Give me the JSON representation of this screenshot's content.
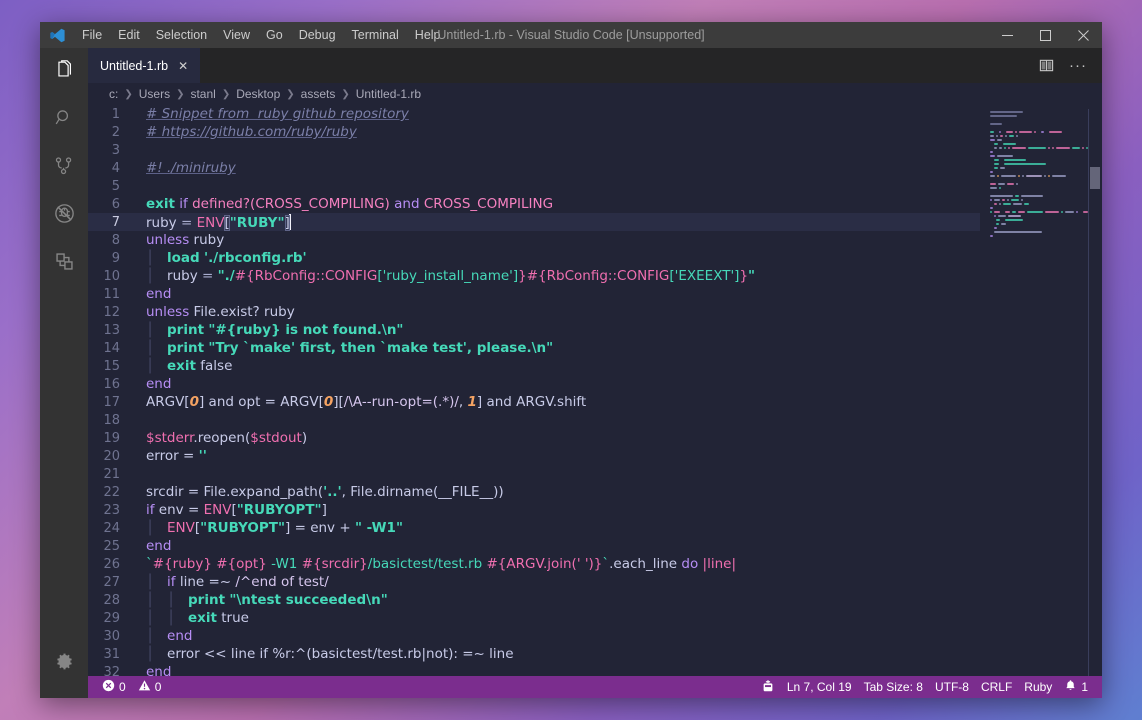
{
  "window": {
    "title": "Untitled-1.rb - Visual Studio Code [Unsupported]",
    "logo_icon": "vscode-logo-icon",
    "minimize_icon": "minimize-icon",
    "maximize_icon": "maximize-icon",
    "close_icon": "close-icon"
  },
  "menubar": {
    "items": [
      {
        "label": "File"
      },
      {
        "label": "Edit"
      },
      {
        "label": "Selection"
      },
      {
        "label": "View"
      },
      {
        "label": "Go"
      },
      {
        "label": "Debug"
      },
      {
        "label": "Terminal"
      },
      {
        "label": "Help"
      }
    ]
  },
  "activitybar": {
    "items": [
      {
        "name": "explorer",
        "icon": "files-icon",
        "active": true
      },
      {
        "name": "search",
        "icon": "search-icon",
        "active": false
      },
      {
        "name": "source-control",
        "icon": "source-control-icon",
        "active": false
      },
      {
        "name": "debug",
        "icon": "debug-disabled-icon",
        "active": false
      },
      {
        "name": "extensions",
        "icon": "extensions-icon",
        "active": false
      }
    ],
    "manage": {
      "name": "manage",
      "icon": "gear-icon"
    }
  },
  "tabs": {
    "items": [
      {
        "label": "Untitled-1.rb",
        "close_label": "✕",
        "active": true
      }
    ],
    "actions": [
      {
        "name": "split-editor",
        "icon": "split-editor-icon"
      },
      {
        "name": "more-actions",
        "icon": "ellipsis-icon",
        "label": "···"
      }
    ]
  },
  "breadcrumbs": {
    "separator": "❯",
    "items": [
      "c:",
      "Users",
      "stanl",
      "Desktop",
      "assets",
      "Untitled-1.rb"
    ]
  },
  "editor": {
    "language": "Ruby",
    "current_line": 7,
    "lines": [
      {
        "n": 1,
        "tokens": [
          {
            "t": "com",
            "v": "# Snippet from  ruby github repository"
          }
        ]
      },
      {
        "n": 2,
        "tokens": [
          {
            "t": "com",
            "v": "# https://github.com/ruby/ruby"
          }
        ]
      },
      {
        "n": 3,
        "tokens": []
      },
      {
        "n": 4,
        "tokens": [
          {
            "t": "com",
            "v": "#! ./miniruby"
          }
        ]
      },
      {
        "n": 5,
        "tokens": []
      },
      {
        "n": 6,
        "tokens": [
          {
            "t": "kw2",
            "v": "exit"
          },
          {
            "t": "plain",
            "v": " "
          },
          {
            "t": "kw",
            "v": "if"
          },
          {
            "t": "plain",
            "v": " "
          },
          {
            "t": "const",
            "v": "defined?"
          },
          {
            "t": "const",
            "v": "("
          },
          {
            "t": "const",
            "v": "CROSS_COMPILING"
          },
          {
            "t": "const",
            "v": ")"
          },
          {
            "t": "plain",
            "v": " "
          },
          {
            "t": "kw",
            "v": "and"
          },
          {
            "t": "plain",
            "v": " "
          },
          {
            "t": "const",
            "v": "CROSS_COMPILING"
          }
        ]
      },
      {
        "n": 7,
        "tokens": [
          {
            "t": "plain",
            "v": "ruby"
          },
          {
            "t": "op",
            "v": " = "
          },
          {
            "t": "var",
            "v": "ENV"
          },
          {
            "t": "hl",
            "v": "["
          },
          {
            "t": "str",
            "v": "\"RUBY\""
          },
          {
            "t": "hl",
            "v": "]"
          },
          {
            "t": "caret",
            "v": ""
          }
        ]
      },
      {
        "n": 8,
        "tokens": [
          {
            "t": "kw",
            "v": "unless"
          },
          {
            "t": "plain",
            "v": " ruby"
          }
        ]
      },
      {
        "n": 9,
        "tokens": [
          {
            "t": "guide",
            "v": "│   "
          },
          {
            "t": "fn",
            "v": "load"
          },
          {
            "t": "plain",
            "v": " "
          },
          {
            "t": "str",
            "v": "'./rbconfig.rb'"
          }
        ]
      },
      {
        "n": 10,
        "tokens": [
          {
            "t": "guide",
            "v": "│   "
          },
          {
            "t": "plain",
            "v": "ruby"
          },
          {
            "t": "op",
            "v": " = "
          },
          {
            "t": "str",
            "v": "\"./"
          },
          {
            "t": "interp",
            "v": "#{"
          },
          {
            "t": "var",
            "v": "RbConfig::CONFIG"
          },
          {
            "t": "str2",
            "v": "['ruby_install_name']"
          },
          {
            "t": "interp",
            "v": "}"
          },
          {
            "t": "interp",
            "v": "#{"
          },
          {
            "t": "var",
            "v": "RbConfig::CONFIG"
          },
          {
            "t": "str2",
            "v": "['EXEEXT']"
          },
          {
            "t": "interp",
            "v": "}"
          },
          {
            "t": "str",
            "v": "\""
          }
        ]
      },
      {
        "n": 11,
        "tokens": [
          {
            "t": "kw",
            "v": "end"
          }
        ]
      },
      {
        "n": 12,
        "tokens": [
          {
            "t": "kw",
            "v": "unless"
          },
          {
            "t": "plain",
            "v": " File.exist? ruby"
          }
        ]
      },
      {
        "n": 13,
        "tokens": [
          {
            "t": "guide",
            "v": "│   "
          },
          {
            "t": "fn",
            "v": "print"
          },
          {
            "t": "plain",
            "v": " "
          },
          {
            "t": "str",
            "v": "\"#{ruby} is not found.\\n\""
          }
        ]
      },
      {
        "n": 14,
        "tokens": [
          {
            "t": "guide",
            "v": "│   "
          },
          {
            "t": "fn",
            "v": "print"
          },
          {
            "t": "plain",
            "v": " "
          },
          {
            "t": "str",
            "v": "\"Try `make' first, then `make test', please.\\n\""
          }
        ]
      },
      {
        "n": 15,
        "tokens": [
          {
            "t": "guide",
            "v": "│   "
          },
          {
            "t": "kw2",
            "v": "exit"
          },
          {
            "t": "plain",
            "v": " false"
          }
        ]
      },
      {
        "n": 16,
        "tokens": [
          {
            "t": "kw",
            "v": "end"
          }
        ]
      },
      {
        "n": 17,
        "tokens": [
          {
            "t": "plain",
            "v": "ARGV["
          },
          {
            "t": "num",
            "v": "0"
          },
          {
            "t": "plain",
            "v": "] and opt = ARGV["
          },
          {
            "t": "num",
            "v": "0"
          },
          {
            "t": "plain",
            "v": "]["
          },
          {
            "t": "re",
            "v": "/\\A--run-opt=(.*)/"
          },
          {
            "t": "plain",
            "v": ", "
          },
          {
            "t": "num",
            "v": "1"
          },
          {
            "t": "plain",
            "v": "] and ARGV.shift"
          }
        ]
      },
      {
        "n": 18,
        "tokens": []
      },
      {
        "n": 19,
        "tokens": [
          {
            "t": "var",
            "v": "$stderr"
          },
          {
            "t": "plain",
            "v": ".reopen("
          },
          {
            "t": "var",
            "v": "$stdout"
          },
          {
            "t": "plain",
            "v": ")"
          }
        ]
      },
      {
        "n": 20,
        "tokens": [
          {
            "t": "plain",
            "v": "error = "
          },
          {
            "t": "str",
            "v": "''"
          }
        ]
      },
      {
        "n": 21,
        "tokens": []
      },
      {
        "n": 22,
        "tokens": [
          {
            "t": "plain",
            "v": "srcdir = File.expand_path("
          },
          {
            "t": "str",
            "v": "'..'"
          },
          {
            "t": "plain",
            "v": ", File.dirname(__FILE__))"
          }
        ]
      },
      {
        "n": 23,
        "tokens": [
          {
            "t": "kw",
            "v": "if"
          },
          {
            "t": "plain",
            "v": " env = "
          },
          {
            "t": "var",
            "v": "ENV"
          },
          {
            "t": "plain",
            "v": "["
          },
          {
            "t": "str",
            "v": "\"RUBYOPT\""
          },
          {
            "t": "plain",
            "v": "]"
          }
        ]
      },
      {
        "n": 24,
        "tokens": [
          {
            "t": "guide",
            "v": "│   "
          },
          {
            "t": "var",
            "v": "ENV"
          },
          {
            "t": "plain",
            "v": "["
          },
          {
            "t": "str",
            "v": "\"RUBYOPT\""
          },
          {
            "t": "plain",
            "v": "] = env + "
          },
          {
            "t": "str",
            "v": "\" -W1\""
          }
        ]
      },
      {
        "n": 25,
        "tokens": [
          {
            "t": "kw",
            "v": "end"
          }
        ]
      },
      {
        "n": 26,
        "tokens": [
          {
            "t": "str2",
            "v": "`"
          },
          {
            "t": "interp",
            "v": "#{ruby}"
          },
          {
            "t": "str2",
            "v": " "
          },
          {
            "t": "interp",
            "v": "#{opt}"
          },
          {
            "t": "str2",
            "v": " -W1 "
          },
          {
            "t": "interp",
            "v": "#{srcdir}"
          },
          {
            "t": "str2",
            "v": "/basictest/test.rb "
          },
          {
            "t": "interp",
            "v": "#{ARGV.join(' ')}"
          },
          {
            "t": "str2",
            "v": "`"
          },
          {
            "t": "plain",
            "v": ".each_line "
          },
          {
            "t": "kw",
            "v": "do"
          },
          {
            "t": "plain",
            "v": " "
          },
          {
            "t": "var",
            "v": "|line|"
          }
        ]
      },
      {
        "n": 27,
        "tokens": [
          {
            "t": "guide",
            "v": "│   "
          },
          {
            "t": "kw",
            "v": "if"
          },
          {
            "t": "plain",
            "v": " line =~ "
          },
          {
            "t": "re",
            "v": "/^end of test/"
          }
        ]
      },
      {
        "n": 28,
        "tokens": [
          {
            "t": "guide",
            "v": "│   │   "
          },
          {
            "t": "fn",
            "v": "print"
          },
          {
            "t": "plain",
            "v": " "
          },
          {
            "t": "str",
            "v": "\"\\ntest succeeded\\n\""
          }
        ]
      },
      {
        "n": 29,
        "tokens": [
          {
            "t": "guide",
            "v": "│   │   "
          },
          {
            "t": "kw2",
            "v": "exit"
          },
          {
            "t": "plain",
            "v": " true"
          }
        ]
      },
      {
        "n": 30,
        "tokens": [
          {
            "t": "guide",
            "v": "│   "
          },
          {
            "t": "kw",
            "v": "end"
          }
        ]
      },
      {
        "n": 31,
        "tokens": [
          {
            "t": "guide",
            "v": "│   "
          },
          {
            "t": "plain",
            "v": "error << line if %r:^(basictest/test.rb|not): =~ line"
          }
        ]
      },
      {
        "n": 32,
        "tokens": [
          {
            "t": "kw",
            "v": "end"
          }
        ]
      }
    ]
  },
  "statusbar": {
    "background": "#7b2d8e",
    "left": [
      {
        "name": "problems",
        "icon": "error-icon",
        "label": "0",
        "icon2": "warning-icon",
        "label2": "0"
      }
    ],
    "right": [
      {
        "name": "remote-indicator",
        "icon": "remote-icon",
        "label": ""
      },
      {
        "name": "cursor-position",
        "label": "Ln 7, Col 19"
      },
      {
        "name": "tab-size",
        "label": "Tab Size: 8"
      },
      {
        "name": "encoding",
        "label": "UTF-8"
      },
      {
        "name": "eol",
        "label": "CRLF"
      },
      {
        "name": "language-mode",
        "label": "Ruby"
      },
      {
        "name": "notifications",
        "icon": "bell-icon",
        "label": "1"
      }
    ]
  }
}
